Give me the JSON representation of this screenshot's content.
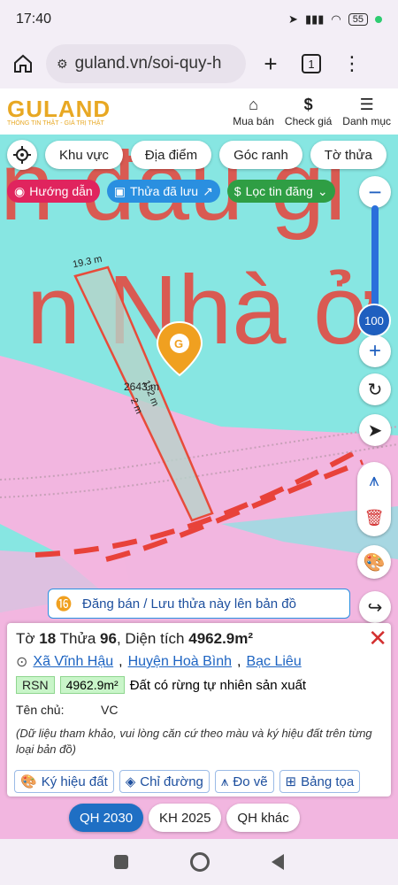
{
  "status": {
    "time": "17:40",
    "battery": "55"
  },
  "browser": {
    "url": "guland.vn/soi-quy-h",
    "tab_count": "1"
  },
  "site": {
    "brand": "GULAND",
    "slogan": "THÔNG TIN THẬT - GIÁ TRỊ THẬT",
    "nav": [
      {
        "label": "Mua bán",
        "icon": "building-icon"
      },
      {
        "label": "Check giá",
        "icon": "dollar-icon"
      },
      {
        "label": "Danh mục",
        "icon": "menu-icon"
      }
    ]
  },
  "chips": [
    "Khu vực",
    "Địa điểm",
    "Góc ranh",
    "Tờ thửa"
  ],
  "pills": {
    "guide": "Hướng dẫn",
    "saved": "Thửa đã lưu",
    "filter": "Lọc tin đăng"
  },
  "map": {
    "zoom_label": "100",
    "dim_top": "19.3 m",
    "dim_long_a": "2643 m",
    "dim_long_b": "152 m",
    "dim_right": "2 m",
    "post_label": "Đăng bán / Lưu thửa này lên bản đồ"
  },
  "parcel": {
    "to_label": "Tờ",
    "to_value": "18",
    "thua_label": "Thửa",
    "thua_value": "96",
    "area_label": "Diện tích",
    "area_value": "4962.9m²",
    "commune": "Xã Vĩnh Hậu",
    "district": "Huyện Hoà Bình",
    "province": "Bạc Liêu",
    "land_code": "RSN",
    "land_area": "4962.9m²",
    "land_type": "Đất có rừng tự nhiên sản xuất",
    "owner_label": "Tên chủ:",
    "owner_value": "VC",
    "note": "(Dữ liệu tham khảo, vui lòng căn cứ theo màu và ký hiệu đất trên từng loại bản đồ)"
  },
  "actions": [
    "Ký hiệu đất",
    "Chỉ đường",
    "Đo vẽ",
    "Bảng tọa"
  ],
  "layers": [
    "QH 2030",
    "KH 2025",
    "QH khác"
  ],
  "colors": {
    "map_cyan": "#87e6e2",
    "map_pink": "#f2b6e0",
    "map_red_text": "#e8423a",
    "accent_blue": "#1f6fc4",
    "brand_gold": "#e8a823"
  }
}
